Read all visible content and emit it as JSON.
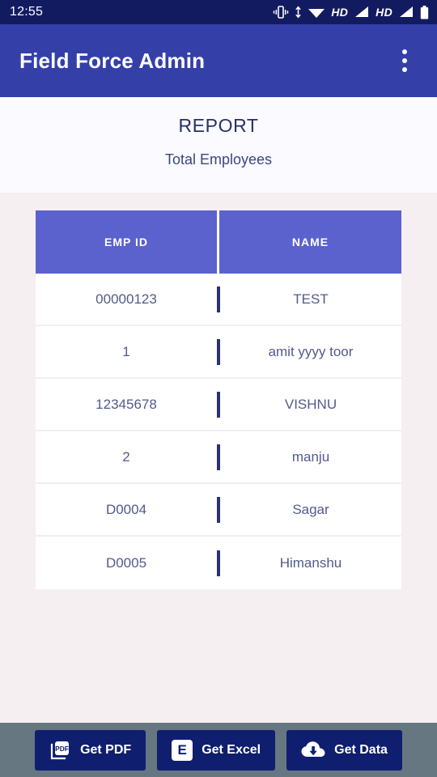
{
  "status_bar": {
    "time": "12:55",
    "icons": [
      "vibrate-icon",
      "data-transfer-icon",
      "wifi-icon",
      "hd-1",
      "signal-1-icon",
      "hd-2",
      "signal-2-icon",
      "battery-icon"
    ],
    "hd_label_1": "HD",
    "hd_label_2": "HD"
  },
  "app_bar": {
    "title": "Field Force Admin",
    "overflow_icon": "more-vertical-icon"
  },
  "report": {
    "title": "REPORT",
    "subtitle": "Total Employees"
  },
  "table": {
    "columns": [
      "EMP ID",
      "NAME"
    ],
    "rows": [
      {
        "emp_id": "00000123",
        "name": "TEST"
      },
      {
        "emp_id": "1",
        "name": "amit yyyy toor"
      },
      {
        "emp_id": "12345678",
        "name": "VISHNU"
      },
      {
        "emp_id": "2",
        "name": "manju"
      },
      {
        "emp_id": "D0004",
        "name": "Sagar"
      },
      {
        "emp_id": "D0005",
        "name": "Himanshu"
      }
    ]
  },
  "actions": [
    {
      "label": "Get PDF",
      "icon": "pdf-file-icon"
    },
    {
      "label": "Get Excel",
      "icon": "excel-file-icon"
    },
    {
      "label": "Get Data",
      "icon": "cloud-download-icon"
    }
  ],
  "colors": {
    "status_bar": "#131b60",
    "app_bar": "#3440a8",
    "table_header": "#5b62ce",
    "action_bar": "#667782",
    "action_button": "#0f1e6e",
    "cell_text": "#525a8a"
  }
}
